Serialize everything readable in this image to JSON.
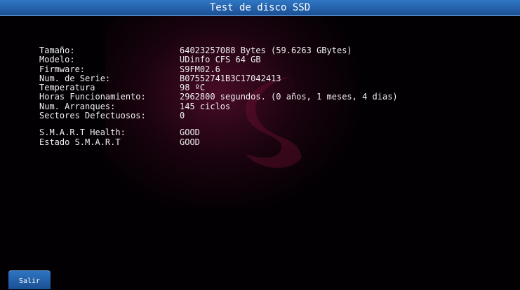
{
  "window": {
    "title": "Test de disco SSD"
  },
  "disk_info": [
    {
      "label": "Tamaño:",
      "value": "64023257088 Bytes (59.6263 GBytes)"
    },
    {
      "label": "Modelo:",
      "value": "UDinfo CFS 64 GB"
    },
    {
      "label": "Firmware:",
      "value": "S9FM02.6"
    },
    {
      "label": "Num. de Serie:",
      "value": "B07552741B3C17042413"
    },
    {
      "label": "Temperatura",
      "value": "98 ºC"
    },
    {
      "label": "Horas Funcionamiento:",
      "value": "2962800 segundos. (0 años, 1 meses, 4 dias)"
    },
    {
      "label": "Num. Arranques:",
      "value": "145 ciclos"
    },
    {
      "label": "Sectores Defectuosos:",
      "value": "0"
    }
  ],
  "smart_info": [
    {
      "label": "S.M.A.R.T Health:",
      "value": "GOOD"
    },
    {
      "label": "Estado S.M.A.R.T",
      "value": "GOOD"
    }
  ],
  "footer": {
    "exit_label": "Salir"
  },
  "colors": {
    "title_bar": "#1b4f93",
    "background": "#020003",
    "accent_glow": "#82144a"
  }
}
